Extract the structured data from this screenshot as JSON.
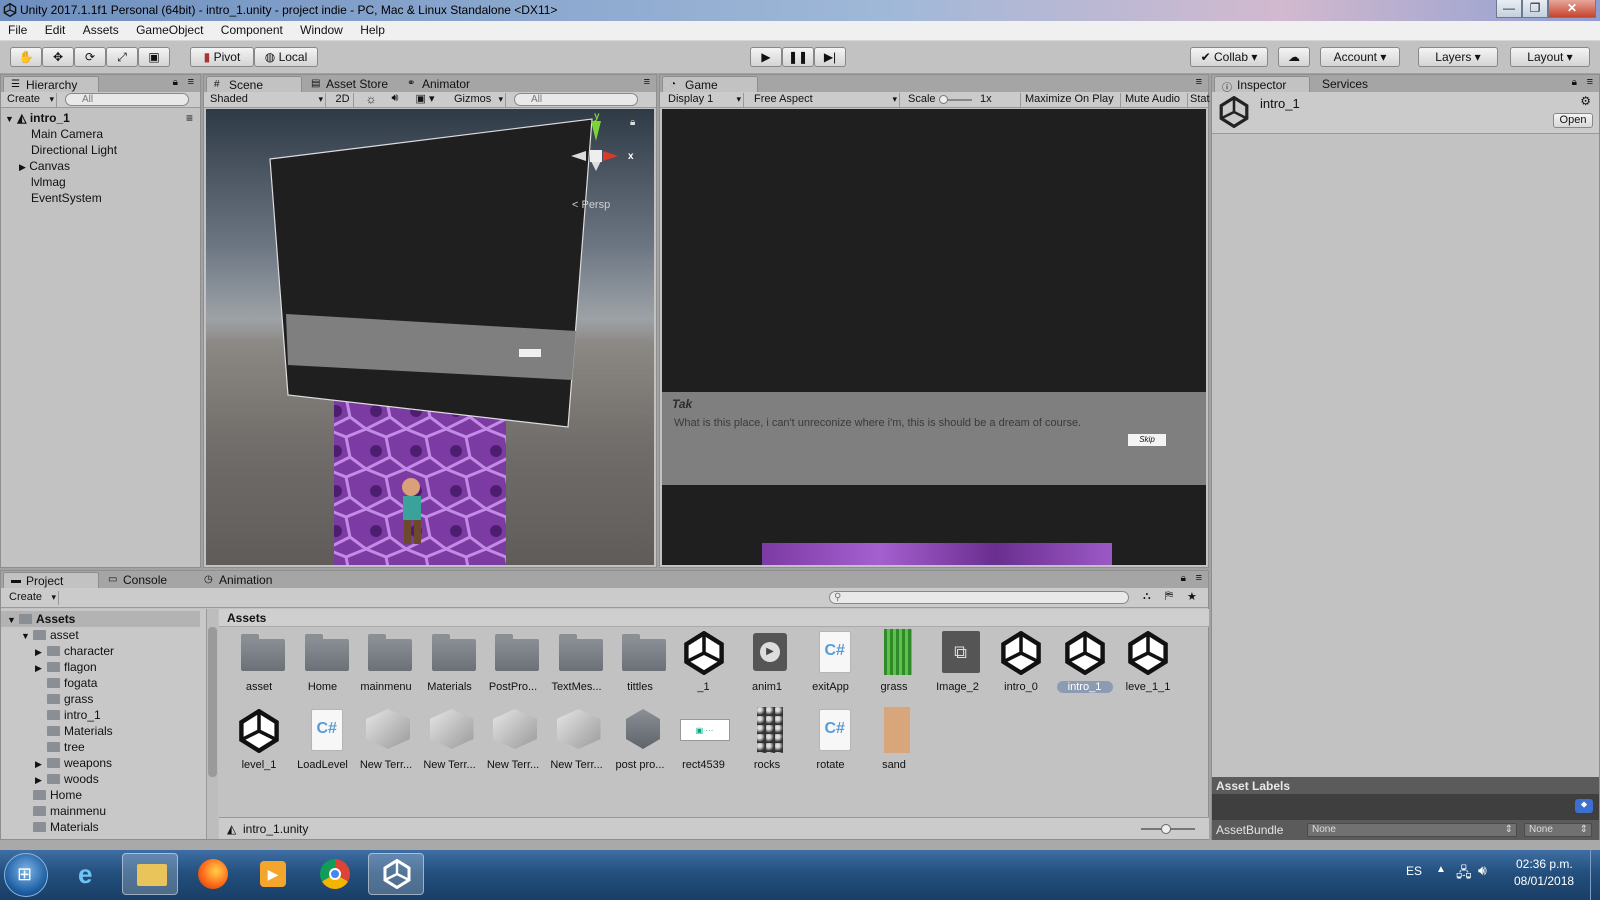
{
  "window": {
    "title": "Unity 2017.1.1f1 Personal (64bit) - intro_1.unity - project indie - PC, Mac & Linux Standalone <DX11>",
    "minimize": "—",
    "maximize": "❐",
    "close": "✕"
  },
  "menu": [
    "File",
    "Edit",
    "Assets",
    "GameObject",
    "Component",
    "Window",
    "Help"
  ],
  "toolbar": {
    "pivot": "Pivot",
    "local": "Local",
    "collab": "Collab",
    "account": "Account",
    "layers": "Layers",
    "layout": "Layout"
  },
  "hierarchy": {
    "tab": "Hierarchy",
    "create": "Create",
    "search_placeholder": "All",
    "scene": "intro_1",
    "items": [
      "Main Camera",
      "Directional Light",
      "Canvas",
      "lvlmag",
      "EventSystem"
    ]
  },
  "scene": {
    "tabs": [
      "Scene",
      "Asset Store",
      "Animator"
    ],
    "shading": "Shaded",
    "mode2d": "2D",
    "gizmos": "Gizmos",
    "search_placeholder": "All",
    "persp": "< Persp",
    "axis_y": "y",
    "axis_x": "x"
  },
  "game": {
    "tab": "Game",
    "display": "Display 1",
    "aspect": "Free Aspect",
    "scale_label": "Scale",
    "scale_value": "1x",
    "maximize": "Maximize On Play",
    "mute": "Mute Audio",
    "stats": "Stat",
    "dialog_name": "Tak",
    "dialog_text": "What is this place, i can't unreconize where i'm, this is should be a dream of course.",
    "skip": "Skip"
  },
  "inspector": {
    "tabs": [
      "Inspector",
      "Services"
    ],
    "object_name": "intro_1",
    "open": "Open",
    "asset_labels": "Asset Labels",
    "assetbundle_label": "AssetBundle",
    "assetbundle_value": "None",
    "assetbundle_variant": "None"
  },
  "project": {
    "tabs": [
      "Project",
      "Console",
      "Animation"
    ],
    "create": "Create",
    "breadcrumb": "Assets",
    "footer": "intro_1.unity",
    "tree": [
      {
        "label": "Assets",
        "depth": 0,
        "arrow": "▼"
      },
      {
        "label": "asset",
        "depth": 1,
        "arrow": "▼"
      },
      {
        "label": "character",
        "depth": 2,
        "arrow": "▶"
      },
      {
        "label": "flagon",
        "depth": 2,
        "arrow": "▶"
      },
      {
        "label": "fogata",
        "depth": 2,
        "arrow": ""
      },
      {
        "label": "grass",
        "depth": 2,
        "arrow": ""
      },
      {
        "label": "intro_1",
        "depth": 2,
        "arrow": ""
      },
      {
        "label": "Materials",
        "depth": 2,
        "arrow": ""
      },
      {
        "label": "tree",
        "depth": 2,
        "arrow": ""
      },
      {
        "label": "weapons",
        "depth": 2,
        "arrow": "▶"
      },
      {
        "label": "woods",
        "depth": 2,
        "arrow": "▶"
      },
      {
        "label": "Home",
        "depth": 1,
        "arrow": ""
      },
      {
        "label": "mainmenu",
        "depth": 1,
        "arrow": ""
      },
      {
        "label": "Materials",
        "depth": 1,
        "arrow": ""
      }
    ],
    "assets_row1": [
      {
        "label": "asset",
        "type": "folder"
      },
      {
        "label": "Home",
        "type": "folder"
      },
      {
        "label": "mainmenu",
        "type": "folder"
      },
      {
        "label": "Materials",
        "type": "folder"
      },
      {
        "label": "PostPro...",
        "type": "folder"
      },
      {
        "label": "TextMes...",
        "type": "folder"
      },
      {
        "label": "tittles",
        "type": "folder"
      },
      {
        "label": "_1",
        "type": "unity"
      },
      {
        "label": "anim1",
        "type": "anim"
      },
      {
        "label": "exitApp",
        "type": "script"
      },
      {
        "label": "grass",
        "type": "grass"
      },
      {
        "label": "Image_2",
        "type": "image"
      },
      {
        "label": "intro_0",
        "type": "unity"
      },
      {
        "label": "intro_1",
        "type": "unity",
        "selected": true
      },
      {
        "label": "leve_1_1",
        "type": "unity"
      }
    ],
    "assets_row2": [
      {
        "label": "level_1",
        "type": "unity"
      },
      {
        "label": "LoadLevel",
        "type": "script"
      },
      {
        "label": "New Terr...",
        "type": "terrain"
      },
      {
        "label": "New Terr...",
        "type": "terrain"
      },
      {
        "label": "New Terr...",
        "type": "terrain"
      },
      {
        "label": "New Terr...",
        "type": "terrain"
      },
      {
        "label": "post pro...",
        "type": "postpro"
      },
      {
        "label": "rect4539",
        "type": "rect"
      },
      {
        "label": "rocks",
        "type": "rocks"
      },
      {
        "label": "rotate",
        "type": "script"
      },
      {
        "label": "sand",
        "type": "sand"
      }
    ]
  },
  "taskbar": {
    "lang": "ES",
    "time": "02:36 p.m.",
    "date": "08/01/2018"
  }
}
